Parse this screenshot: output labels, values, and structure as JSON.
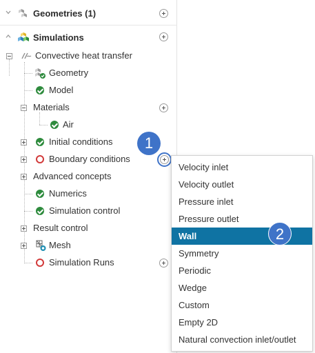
{
  "tree": {
    "geometries_label": "Geometries (1)",
    "simulations_label": "Simulations",
    "nodes": {
      "convective": "Convective heat transfer",
      "geometry": "Geometry",
      "model": "Model",
      "materials": "Materials",
      "air": "Air",
      "initial_conditions": "Initial conditions",
      "boundary_conditions": "Boundary conditions",
      "advanced_concepts": "Advanced concepts",
      "numerics": "Numerics",
      "simulation_control": "Simulation control",
      "result_control": "Result control",
      "mesh": "Mesh",
      "simulation_runs": "Simulation Runs"
    }
  },
  "menu": {
    "items": [
      "Velocity inlet",
      "Velocity outlet",
      "Pressure inlet",
      "Pressure outlet",
      "Wall",
      "Symmetry",
      "Periodic",
      "Wedge",
      "Custom",
      "Empty 2D",
      "Natural convection inlet/outlet"
    ],
    "selected": "Wall"
  },
  "callouts": {
    "step1": "1",
    "step2": "2"
  },
  "colors": {
    "status_ok": "#2e8b3d",
    "status_error": "#d23a3a",
    "selected_bg": "#0f73a3",
    "callout": "#3f73c8"
  }
}
